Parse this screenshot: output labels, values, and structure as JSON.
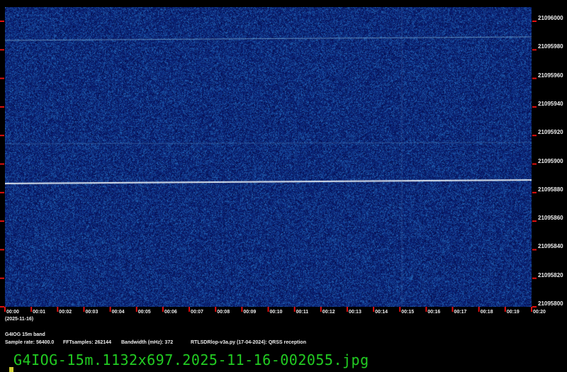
{
  "y_axis": {
    "labels": [
      "21096000",
      "21095980",
      "21095960",
      "21095940",
      "21095920",
      "21095900",
      "21095880",
      "21095860",
      "21095840",
      "21095820",
      "21095800"
    ]
  },
  "x_axis": {
    "labels": [
      "00:00",
      "00:01",
      "00:02",
      "00:03",
      "00:04",
      "00:05",
      "00:06",
      "00:07",
      "00:08",
      "00:09",
      "00:10",
      "00:11",
      "00:12",
      "00:13",
      "00:14",
      "00:15",
      "00:16",
      "00:17",
      "00:18",
      "00:19",
      "00:20"
    ],
    "date": "(2025-11-16)"
  },
  "info": {
    "band": "G4IOG 15m band",
    "sample_rate": "Sample rate: 56400.0",
    "fft": "FFTsamples: 262144",
    "bandwidth": "Bandwidth (mHz): 372",
    "program": "RTLSDRlop-v3a.py (17-04-2024): QRSS reception"
  },
  "filename": "G4IOG-15m.1132x697.2025-11-16-002055.jpg",
  "colors": {
    "background": "#0a1f6e",
    "signal": "#e0e8f0",
    "tick": "#e01010",
    "filename": "#22cc22"
  }
}
